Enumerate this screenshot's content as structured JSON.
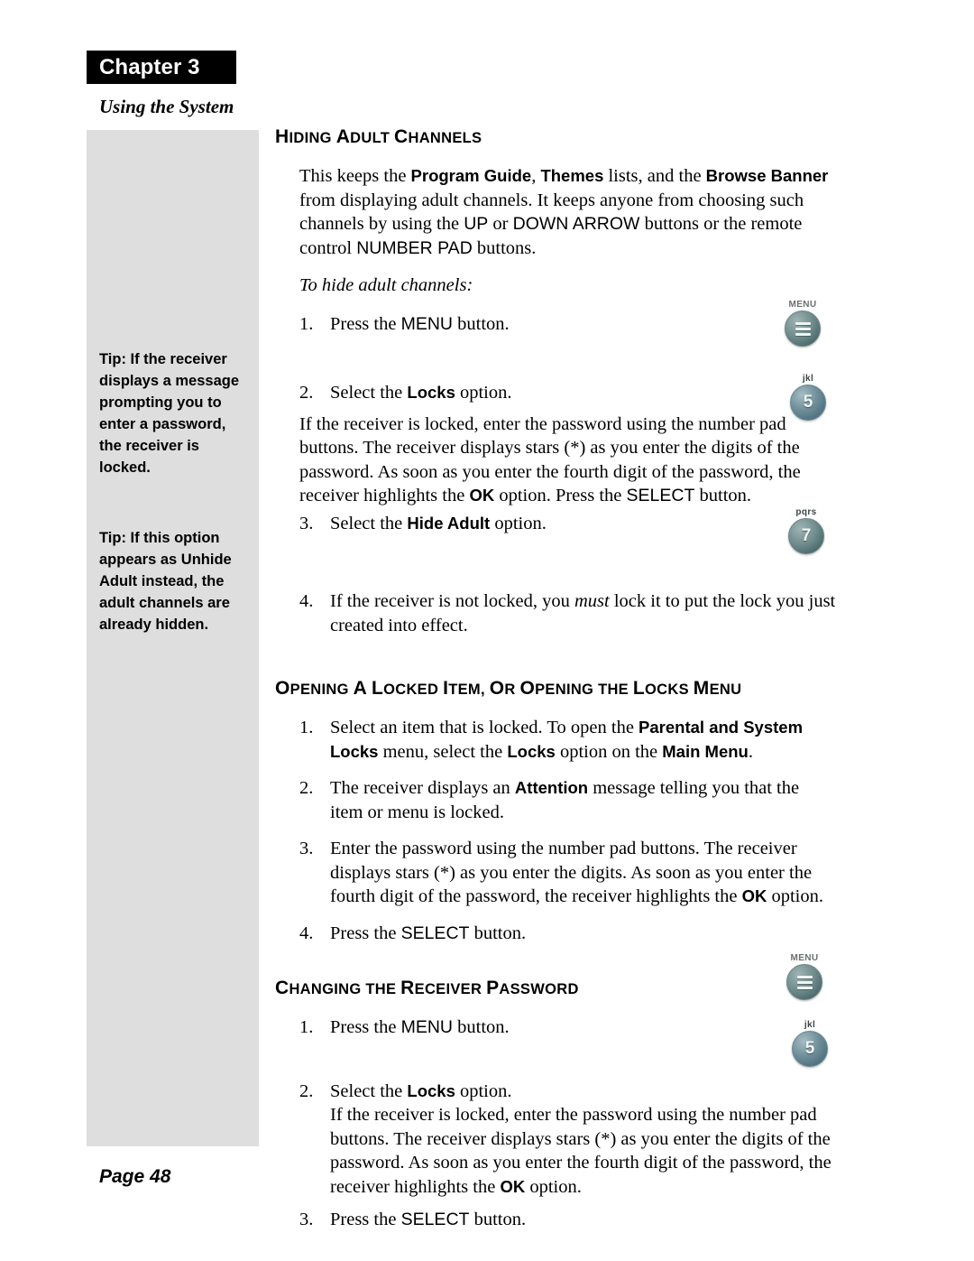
{
  "header": {
    "chapter_label": "Chapter 3",
    "section_subtitle": "Using the System"
  },
  "sidebar": {
    "tips": [
      "Tip: If the receiver displays a message prompting you to enter a password, the receiver is locked.",
      "Tip: If this option appears as Unhide Adult instead, the adult channels are already hidden."
    ]
  },
  "sections": [
    {
      "heading": "HIDING ADULT CHANNELS",
      "intro_1a": "This keeps the ",
      "intro_b1": "Program Guide",
      "intro_1b": ", ",
      "intro_b2": "Themes",
      "intro_1c": " lists, and the ",
      "intro_b3": "Browse Banner",
      "intro_1d": " from displaying adult channels. It keeps anyone from choosing such channels by using the ",
      "intro_s1": "UP",
      "intro_1e": " or ",
      "intro_s2": "DOWN ARROW",
      "intro_1f": " buttons or the remote control ",
      "intro_s3": "NUMBER PAD",
      "intro_1g": " buttons.",
      "lead_in": "To hide adult channels:",
      "steps": [
        {
          "num": "1.",
          "text_a": "Press the ",
          "key": "MENU",
          "text_b": " button."
        },
        {
          "num": "2.",
          "text_a": "Select the ",
          "bold": "Locks",
          "text_b": " option."
        },
        {
          "num": "3.",
          "text_a": "Select the ",
          "bold": "Hide Adult",
          "text_b": " option."
        },
        {
          "num": "4.",
          "text_a": "If the receiver is not locked, you ",
          "italic": "must",
          "text_b": " lock it to put the lock you just created into effect."
        }
      ],
      "note_a": "If the receiver is locked, enter the password using the number pad buttons. The receiver displays stars (*) as you enter the digits of the password. As soon as you enter the fourth digit of the password, the receiver highlights the ",
      "note_ok": "OK",
      "note_b": " option. Press the ",
      "note_select": "SELECT",
      "note_c": " button."
    },
    {
      "heading": "OPENING A LOCKED ITEM, OR OPENING THE LOCKS MENU",
      "steps": [
        {
          "num": "1.",
          "text_a": "Select an item that is locked. To open the ",
          "b1": "Parental and System Locks",
          "text_b": " menu, select the ",
          "b2": "Locks",
          "text_c": " option on the ",
          "b3": "Main Menu",
          "text_d": "."
        },
        {
          "num": "2.",
          "text_a": "The receiver displays an ",
          "b1": "Attention",
          "text_b": " message telling you that the item or menu is locked."
        },
        {
          "num": "3.",
          "text_a": "Enter the password using the number pad buttons. The receiver displays stars (*) as you enter the digits. As soon as you enter the fourth digit of the password, the receiver highlights the ",
          "b1": "OK",
          "text_b": " option."
        },
        {
          "num": "4.",
          "text_a": "Press the ",
          "key": "SELECT",
          "text_b": " button."
        }
      ]
    },
    {
      "heading": "CHANGING THE RECEIVER PASSWORD",
      "steps": [
        {
          "num": "1.",
          "text_a": "Press the ",
          "key": "MENU",
          "text_b": " button."
        },
        {
          "num": "2.",
          "text_a": "Select the ",
          "bold": "Locks",
          "text_b": " option.",
          "note_a": "If the receiver is locked, enter the password using the number pad buttons. The receiver displays stars (*) as you enter the digits of the password. As soon as you enter the fourth digit of the password, the receiver highlights the ",
          "note_ok": "OK",
          "note_b": " option."
        },
        {
          "num": "3.",
          "text_a": "Press the ",
          "key": "SELECT",
          "text_b": " button."
        }
      ]
    }
  ],
  "remote_icons": [
    {
      "label": "MENU",
      "glyph": "bars",
      "style": "gray"
    },
    {
      "label": "jkl",
      "glyph": "5",
      "style": "blue"
    },
    {
      "label": "pqrs",
      "glyph": "7",
      "style": "gray"
    },
    {
      "label": "MENU",
      "glyph": "bars",
      "style": "gray"
    },
    {
      "label": "jkl",
      "glyph": "5",
      "style": "blue"
    }
  ],
  "footer": {
    "page_label": "Page 48"
  }
}
